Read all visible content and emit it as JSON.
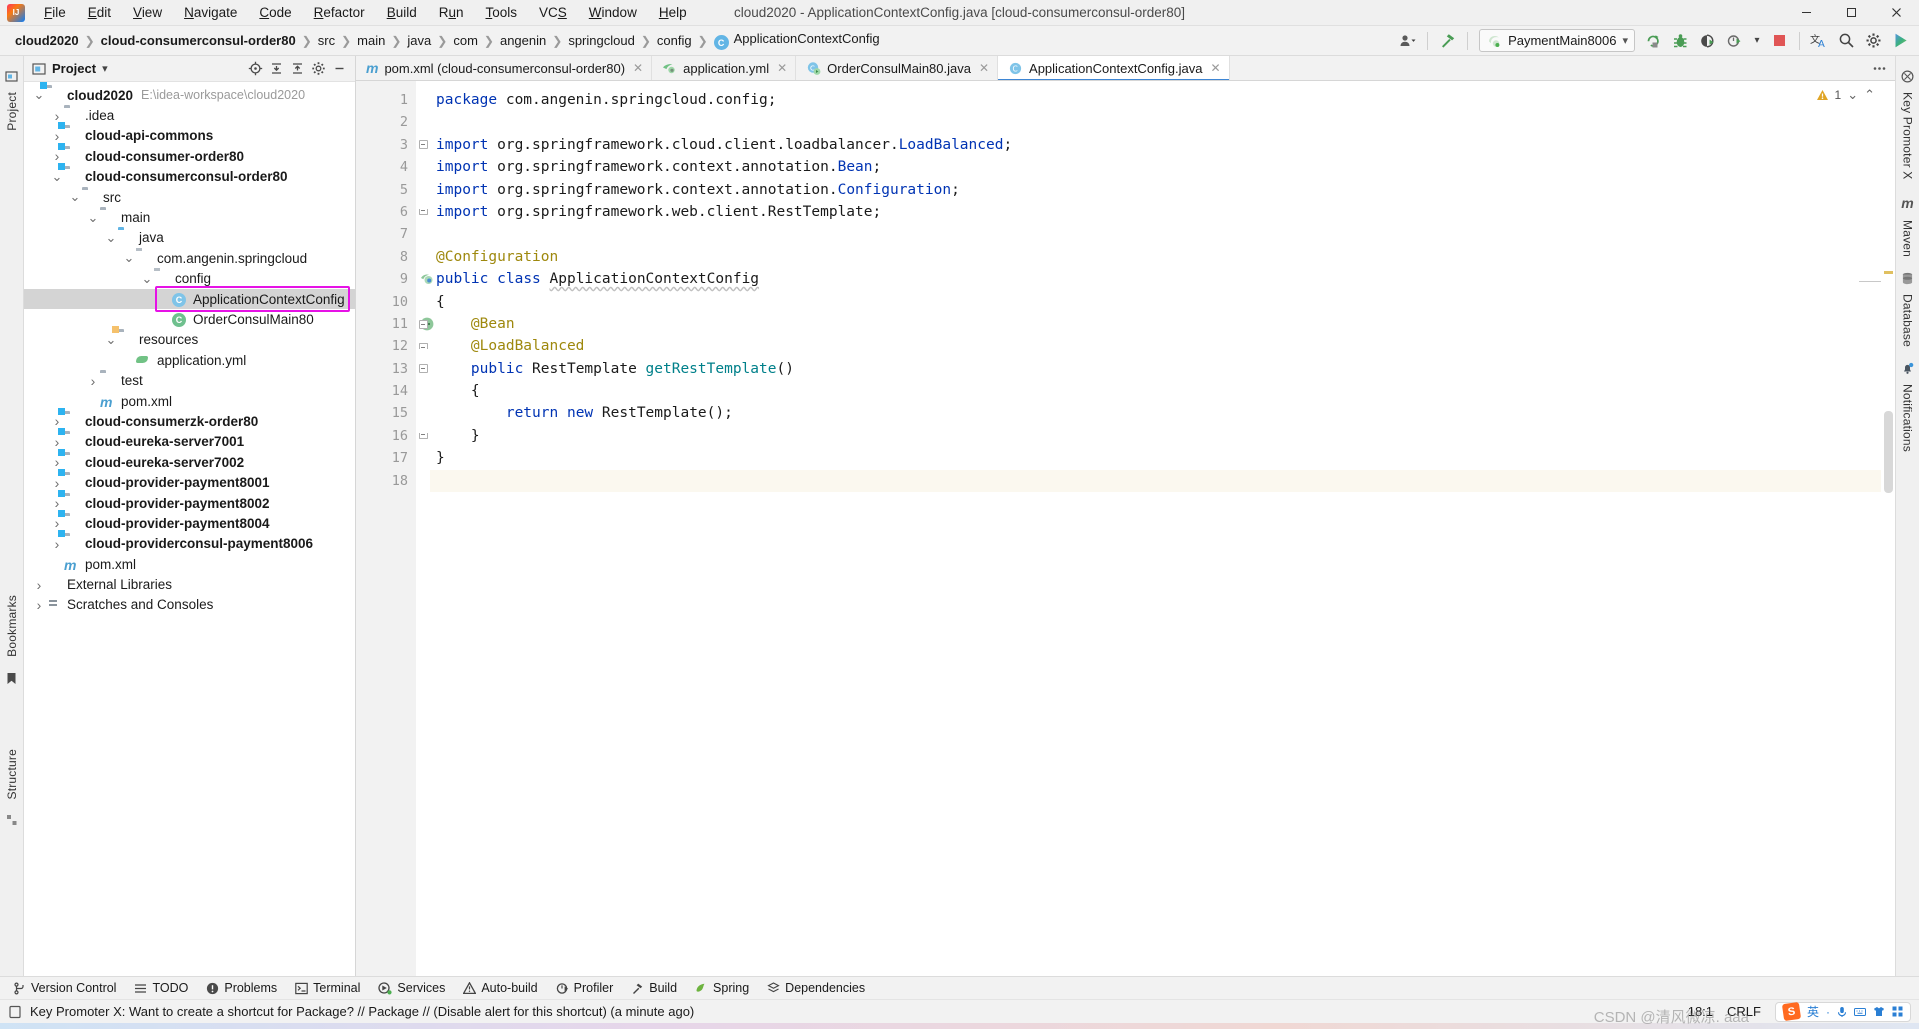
{
  "window": {
    "title": "cloud2020 - ApplicationContextConfig.java [cloud-consumerconsul-order80]",
    "app_icon": "intellij-idea-logo",
    "minimize": "—",
    "maximize": "❐",
    "close": "✕"
  },
  "menubar": [
    {
      "label": "File",
      "mnemonic": "F"
    },
    {
      "label": "Edit",
      "mnemonic": "E"
    },
    {
      "label": "View",
      "mnemonic": "V"
    },
    {
      "label": "Navigate",
      "mnemonic": "N"
    },
    {
      "label": "Code",
      "mnemonic": "C"
    },
    {
      "label": "Refactor",
      "mnemonic": "R"
    },
    {
      "label": "Build",
      "mnemonic": "B"
    },
    {
      "label": "Run",
      "mnemonic": "u"
    },
    {
      "label": "Tools",
      "mnemonic": "T"
    },
    {
      "label": "VCS",
      "mnemonic": "S"
    },
    {
      "label": "Window",
      "mnemonic": "W"
    },
    {
      "label": "Help",
      "mnemonic": "H"
    }
  ],
  "breadcrumbs": [
    {
      "label": "cloud2020",
      "bold": true
    },
    {
      "label": "cloud-consumerconsul-order80",
      "bold": true
    },
    {
      "label": "src",
      "bold": false
    },
    {
      "label": "main",
      "bold": false
    },
    {
      "label": "java",
      "bold": false
    },
    {
      "label": "com",
      "bold": false
    },
    {
      "label": "angenin",
      "bold": false
    },
    {
      "label": "springcloud",
      "bold": false
    },
    {
      "label": "config",
      "bold": false
    },
    {
      "label": "ApplicationContextConfig",
      "bold": false,
      "icon": "C"
    }
  ],
  "toolbar": {
    "run_config": "PaymentMain8006",
    "run_config_icon": "spring-boot-icon",
    "dropdown_caret": "▾",
    "icons": [
      "user-avatar-icon",
      "hammer-build-icon",
      "run-icon",
      "debug-icon",
      "run-with-coverage-icon",
      "profile-icon",
      "stop-icon",
      "translate-icon",
      "search-everywhere-icon",
      "settings-gear-icon",
      "play-colored-icon"
    ]
  },
  "project_panel": {
    "title": "Project",
    "dropdown": "▾",
    "header_icons": [
      "locate-icon",
      "expand-all-icon",
      "collapse-all-icon",
      "settings-gear-icon",
      "hide-icon"
    ],
    "tree": [
      {
        "label": "cloud2020",
        "path": "E:\\idea-workspace\\cloud2020",
        "depth": 0,
        "arrow": "down",
        "icon": "module-folder",
        "bold": true
      },
      {
        "label": ".idea",
        "depth": 1,
        "arrow": "right",
        "icon": "folder",
        "bold": false
      },
      {
        "label": "cloud-api-commons",
        "depth": 1,
        "arrow": "right",
        "icon": "module-folder",
        "bold": true
      },
      {
        "label": "cloud-consumer-order80",
        "depth": 1,
        "arrow": "right",
        "icon": "module-folder",
        "bold": true
      },
      {
        "label": "cloud-consumerconsul-order80",
        "depth": 1,
        "arrow": "down",
        "icon": "module-folder",
        "bold": true
      },
      {
        "label": "src",
        "depth": 2,
        "arrow": "down",
        "icon": "folder",
        "bold": false
      },
      {
        "label": "main",
        "depth": 3,
        "arrow": "down",
        "icon": "folder",
        "bold": false
      },
      {
        "label": "java",
        "depth": 4,
        "arrow": "down",
        "icon": "source-folder",
        "bold": false
      },
      {
        "label": "com.angenin.springcloud",
        "depth": 5,
        "arrow": "down",
        "icon": "package",
        "bold": false
      },
      {
        "label": "config",
        "depth": 6,
        "arrow": "down",
        "icon": "package",
        "bold": false
      },
      {
        "label": "ApplicationContextConfig",
        "depth": 7,
        "arrow": "none",
        "icon": "class",
        "bold": false,
        "selected": true,
        "highlighted": true
      },
      {
        "label": "OrderConsulMain80",
        "depth": 7,
        "arrow": "none",
        "icon": "runnable-class",
        "bold": false
      },
      {
        "label": "resources",
        "depth": 4,
        "arrow": "down",
        "icon": "resource-folder",
        "bold": false
      },
      {
        "label": "application.yml",
        "depth": 5,
        "arrow": "none",
        "icon": "yml-file",
        "bold": false
      },
      {
        "label": "test",
        "depth": 3,
        "arrow": "right",
        "icon": "folder",
        "bold": false
      },
      {
        "label": "pom.xml",
        "depth": 3,
        "arrow": "none",
        "icon": "maven-file",
        "bold": false
      },
      {
        "label": "cloud-consumerzk-order80",
        "depth": 1,
        "arrow": "right",
        "icon": "module-folder",
        "bold": true
      },
      {
        "label": "cloud-eureka-server7001",
        "depth": 1,
        "arrow": "right",
        "icon": "module-folder",
        "bold": true
      },
      {
        "label": "cloud-eureka-server7002",
        "depth": 1,
        "arrow": "right",
        "icon": "module-folder",
        "bold": true
      },
      {
        "label": "cloud-provider-payment8001",
        "depth": 1,
        "arrow": "right",
        "icon": "module-folder",
        "bold": true
      },
      {
        "label": "cloud-provider-payment8002",
        "depth": 1,
        "arrow": "right",
        "icon": "module-folder",
        "bold": true
      },
      {
        "label": "cloud-provider-payment8004",
        "depth": 1,
        "arrow": "right",
        "icon": "module-folder",
        "bold": true
      },
      {
        "label": "cloud-providerconsul-payment8006",
        "depth": 1,
        "arrow": "right",
        "icon": "module-folder",
        "bold": true
      },
      {
        "label": "pom.xml",
        "depth": 1,
        "arrow": "none",
        "icon": "maven-file",
        "bold": false
      },
      {
        "label": "External Libraries",
        "depth": 0,
        "arrow": "right",
        "icon": "libraries",
        "bold": false
      },
      {
        "label": "Scratches and Consoles",
        "depth": 0,
        "arrow": "right",
        "icon": "scratches",
        "bold": false
      }
    ]
  },
  "left_strip": [
    {
      "label": "Project",
      "name": "project"
    },
    {
      "label": "Bookmarks",
      "name": "bookmarks"
    },
    {
      "label": "Structure",
      "name": "structure"
    }
  ],
  "right_strip": [
    {
      "label": "Key Promoter X",
      "name": "key-promoter-x",
      "icon": "key-promoter-icon"
    },
    {
      "label": "Maven",
      "name": "maven",
      "icon": "maven-m-icon"
    },
    {
      "label": "Database",
      "name": "database",
      "icon": "database-icon"
    },
    {
      "label": "Notifications",
      "name": "notifications",
      "icon": "bell-icon"
    }
  ],
  "editor_tabs": [
    {
      "label": "pom.xml (cloud-consumerconsul-order80)",
      "icon": "maven-file-icon",
      "active": false,
      "close": "✕"
    },
    {
      "label": "application.yml",
      "icon": "yml-file-icon",
      "active": false,
      "close": "✕"
    },
    {
      "label": "OrderConsulMain80.java",
      "icon": "runnable-class-icon",
      "active": false,
      "close": "✕"
    },
    {
      "label": "ApplicationContextConfig.java",
      "icon": "class-icon",
      "active": true,
      "close": "✕"
    }
  ],
  "editor": {
    "inspection_warnings": "1",
    "inspection_icon": "warning-triangle-icon",
    "chevron_down": "⌄",
    "chevron_up": "⌃",
    "lines": [
      {
        "n": 1,
        "tokens": [
          {
            "t": "package",
            "c": "kw"
          },
          {
            "t": " com.angenin.springcloud.config;",
            "c": "plain"
          }
        ]
      },
      {
        "n": 2,
        "tokens": []
      },
      {
        "n": 3,
        "fold": "top",
        "tokens": [
          {
            "t": "import",
            "c": "kw"
          },
          {
            "t": " org.springframework.cloud.client.loadbalancer.",
            "c": "plain"
          },
          {
            "t": "LoadBalanced",
            "c": "cls-blue"
          },
          {
            "t": ";",
            "c": "plain"
          }
        ]
      },
      {
        "n": 4,
        "tokens": [
          {
            "t": "import",
            "c": "kw"
          },
          {
            "t": " org.springframework.context.annotation.",
            "c": "plain"
          },
          {
            "t": "Bean",
            "c": "cls-blue"
          },
          {
            "t": ";",
            "c": "plain"
          }
        ]
      },
      {
        "n": 5,
        "tokens": [
          {
            "t": "import",
            "c": "kw"
          },
          {
            "t": " org.springframework.context.annotation.",
            "c": "plain"
          },
          {
            "t": "Configuration",
            "c": "cls-blue"
          },
          {
            "t": ";",
            "c": "plain"
          }
        ]
      },
      {
        "n": 6,
        "fold": "bot",
        "tokens": [
          {
            "t": "import",
            "c": "kw"
          },
          {
            "t": " org.springframework.web.client.RestTemplate;",
            "c": "plain"
          }
        ]
      },
      {
        "n": 7,
        "tokens": []
      },
      {
        "n": 8,
        "tokens": [
          {
            "t": "@Configuration",
            "c": "ann"
          }
        ]
      },
      {
        "n": 9,
        "gutter_icon": "spring-bean-icon",
        "tokens": [
          {
            "t": "public",
            "c": "kw"
          },
          {
            "t": " ",
            "c": "plain"
          },
          {
            "t": "class",
            "c": "kw"
          },
          {
            "t": " ",
            "c": "plain"
          },
          {
            "t": "ApplicationContextConfig",
            "c": "wavy"
          }
        ]
      },
      {
        "n": 10,
        "tokens": [
          {
            "t": "{",
            "c": "plain"
          }
        ]
      },
      {
        "n": 11,
        "gutter_icon": "spring-override-icon",
        "fold": "top",
        "tokens": [
          {
            "t": "    @Bean",
            "c": "ann"
          }
        ]
      },
      {
        "n": 12,
        "fold": "mid",
        "tokens": [
          {
            "t": "    @LoadBalanced",
            "c": "ann"
          }
        ]
      },
      {
        "n": 13,
        "fold": "top",
        "tokens": [
          {
            "t": "    ",
            "c": "plain"
          },
          {
            "t": "public",
            "c": "kw"
          },
          {
            "t": " RestTemplate ",
            "c": "plain"
          },
          {
            "t": "getRestTemplate",
            "c": "mth"
          },
          {
            "t": "()",
            "c": "plain"
          }
        ]
      },
      {
        "n": 14,
        "tokens": [
          {
            "t": "    {",
            "c": "plain"
          }
        ]
      },
      {
        "n": 15,
        "tokens": [
          {
            "t": "        ",
            "c": "plain"
          },
          {
            "t": "return",
            "c": "kw"
          },
          {
            "t": " ",
            "c": "plain"
          },
          {
            "t": "new",
            "c": "kw"
          },
          {
            "t": " RestTemplate();",
            "c": "plain"
          }
        ]
      },
      {
        "n": 16,
        "fold": "bot",
        "tokens": [
          {
            "t": "    }",
            "c": "plain"
          }
        ]
      },
      {
        "n": 17,
        "tokens": [
          {
            "t": "}",
            "c": "plain"
          }
        ]
      },
      {
        "n": 18,
        "caret": true,
        "tokens": []
      }
    ]
  },
  "tool_windows": [
    {
      "label": "Version Control",
      "icon": "branch-icon"
    },
    {
      "label": "TODO",
      "icon": "list-icon"
    },
    {
      "label": "Problems",
      "icon": "error-circle-icon"
    },
    {
      "label": "Terminal",
      "icon": "terminal-icon"
    },
    {
      "label": "Services",
      "icon": "services-icon"
    },
    {
      "label": "Auto-build",
      "icon": "warning-triangle-icon"
    },
    {
      "label": "Profiler",
      "icon": "profiler-icon"
    },
    {
      "label": "Build",
      "icon": "hammer-icon"
    },
    {
      "label": "Spring",
      "icon": "spring-leaf-icon"
    },
    {
      "label": "Dependencies",
      "icon": "dependencies-icon"
    }
  ],
  "statusbar": {
    "message_icon": "key-promoter-icon",
    "message": "Key Promoter X: Want to create a shortcut for Package? // Package // (Disable alert for this shortcut) (a minute ago)",
    "caret_position": "18:1",
    "line_separator": "CRLF",
    "ime": {
      "logo": "S",
      "mode": "英",
      "icons": [
        "dot-icon",
        "microphone-icon",
        "keyboard-icon",
        "clothes-icon",
        "apps-icon"
      ]
    },
    "watermark": "CSDN @清风微凉. aaa"
  }
}
